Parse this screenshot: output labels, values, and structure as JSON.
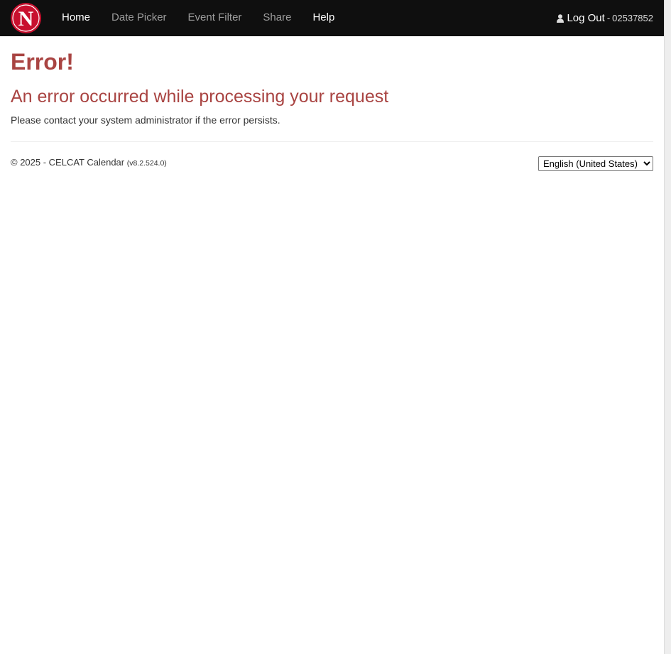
{
  "navbar": {
    "logo_letter": "N",
    "links": [
      {
        "label": "Home",
        "active": true
      },
      {
        "label": "Date Picker",
        "active": false
      },
      {
        "label": "Event Filter",
        "active": false
      },
      {
        "label": "Share",
        "active": false
      },
      {
        "label": "Help",
        "active": true
      }
    ],
    "logout_label": "Log Out",
    "separator": "-",
    "user_id": "02537852"
  },
  "error": {
    "title": "Error!",
    "subtitle": "An error occurred while processing your request",
    "message": "Please contact your system administrator if the error persists."
  },
  "footer": {
    "copyright": "© 2025 - CELCAT Calendar",
    "version": "(v8.2.524.0)",
    "language_selected": "English (United States)"
  },
  "colors": {
    "navbar_bg": "#0f0f0f",
    "error_red": "#a94442",
    "logo_red": "#c8102e"
  },
  "icons": {
    "logo": "university-n-logo",
    "user": "user-icon",
    "dropdown": "chevron-down-icon"
  }
}
